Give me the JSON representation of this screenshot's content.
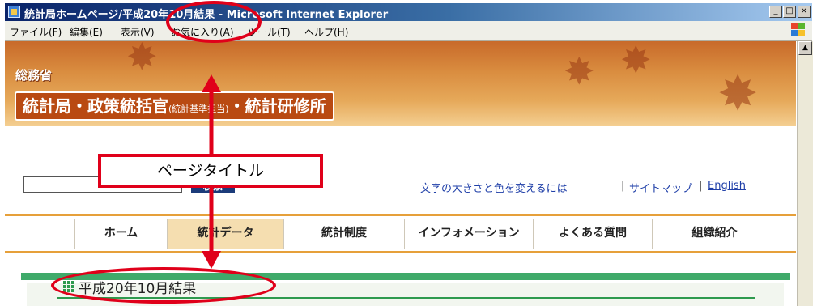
{
  "window": {
    "title": "統計局ホームページ/平成20年10月結果 - Microsoft Internet Explorer",
    "min_label": "_",
    "max_label": "□",
    "close_label": "×"
  },
  "menubar": {
    "items": [
      "ファイル(F)",
      "編集(E)",
      "表示(V)",
      "お気に入り(A)",
      "ツール(T)",
      "ヘルプ(H)"
    ]
  },
  "header": {
    "ministry": "総務省",
    "bureau_main": "統計局・政策統括官",
    "bureau_small": "(統計基準担当)",
    "bureau_tail": "・統計研修所"
  },
  "search": {
    "value": "",
    "button_label": "検索"
  },
  "utility_links": [
    "文字の大きさと色を変えるには",
    "サイトマップ",
    "English"
  ],
  "utility_separator": "|",
  "nav": {
    "items": [
      "ホーム",
      "統計データ",
      "統計制度",
      "インフォメーション",
      "よくある質問",
      "組織紹介"
    ],
    "active": "統計データ"
  },
  "content": {
    "heading": "平成20年10月結果"
  },
  "annotation": {
    "label": "ページタイトル",
    "color": "#e0001a"
  },
  "colors": {
    "title_bar": "#0a246a",
    "nav_accent": "#e6a03a",
    "section_green": "#3faa6a",
    "link_blue": "#1f3fa8"
  }
}
